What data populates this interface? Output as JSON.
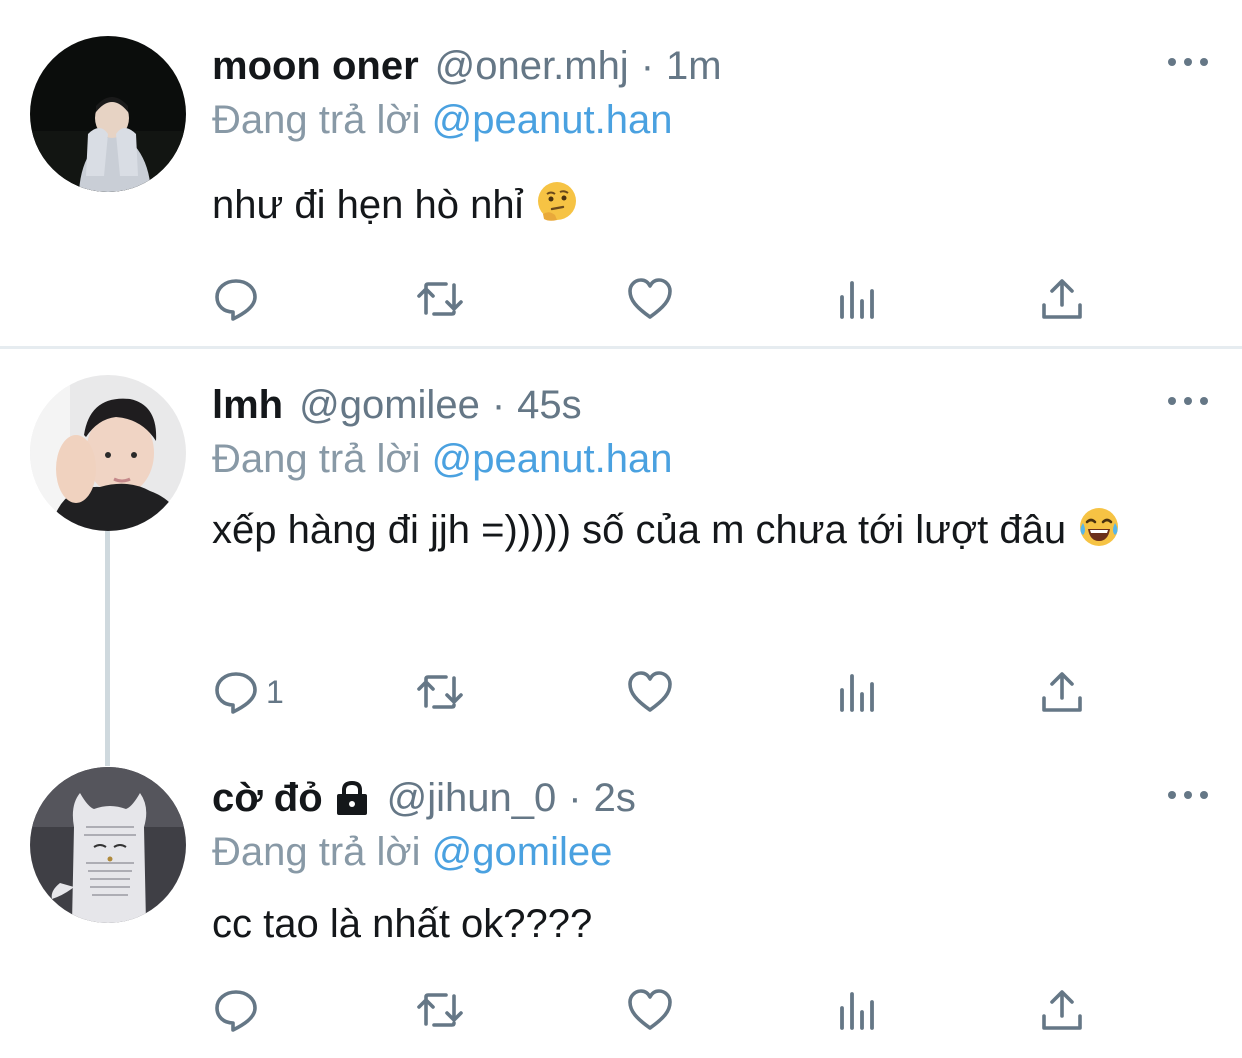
{
  "reply_prefix": "Đang trả lời",
  "tweets": [
    {
      "name": "moon oner",
      "handle": "@oner.mhj",
      "separator": "·",
      "time": "1m",
      "reply_to": "@peanut.han",
      "text": "như đi hẹn hò nhỉ",
      "emoji": "thinking-face",
      "reply_count": "",
      "locked": false
    },
    {
      "name": "lmh",
      "handle": "@gomilee",
      "separator": "·",
      "time": "45s",
      "reply_to": "@peanut.han",
      "text": "xếp hàng đi jjh =))))) số của m chưa tới lượt đâu",
      "emoji": "face-with-tears-of-joy",
      "reply_count": "1",
      "locked": false
    },
    {
      "name": "cờ đỏ",
      "handle": "@jihun_0",
      "separator": "·",
      "time": "2s",
      "reply_to": "@gomilee",
      "text": "cc tao là nhất ok????",
      "emoji": "",
      "reply_count": "",
      "locked": true
    }
  ],
  "icons": [
    "reply-icon",
    "retweet-icon",
    "like-icon",
    "stats-icon",
    "share-icon",
    "more-icon",
    "lock-icon"
  ],
  "colors": {
    "text": "#14171a",
    "muted": "#657786",
    "mention": "#4aa1e0",
    "divider": "#e6ecf0",
    "thread_line": "#cfd9de"
  }
}
